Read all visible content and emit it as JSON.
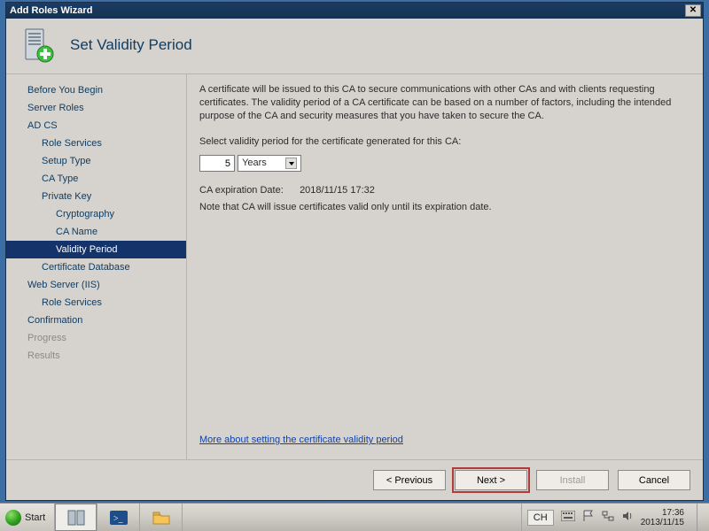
{
  "window": {
    "title": "Add Roles Wizard"
  },
  "header": {
    "heading": "Set Validity Period"
  },
  "sidebar": {
    "items": [
      {
        "label": "Before You Begin",
        "indent": 0
      },
      {
        "label": "Server Roles",
        "indent": 0
      },
      {
        "label": "AD CS",
        "indent": 0
      },
      {
        "label": "Role Services",
        "indent": 1
      },
      {
        "label": "Setup Type",
        "indent": 1
      },
      {
        "label": "CA Type",
        "indent": 1
      },
      {
        "label": "Private Key",
        "indent": 1
      },
      {
        "label": "Cryptography",
        "indent": 2
      },
      {
        "label": "CA Name",
        "indent": 2
      },
      {
        "label": "Validity Period",
        "indent": 2,
        "selected": true
      },
      {
        "label": "Certificate Database",
        "indent": 1
      },
      {
        "label": "Web Server (IIS)",
        "indent": 0
      },
      {
        "label": "Role Services",
        "indent": 1
      },
      {
        "label": "Confirmation",
        "indent": 0
      },
      {
        "label": "Progress",
        "indent": 0,
        "disabled": true
      },
      {
        "label": "Results",
        "indent": 0,
        "disabled": true
      }
    ]
  },
  "content": {
    "description": "A certificate will be issued to this CA to secure communications with other CAs and with clients requesting certificates. The validity period of a CA certificate can be based on a number of factors, including the intended purpose of the CA and security measures that you have taken to secure the CA.",
    "select_label": "Select validity period for the certificate generated for this CA:",
    "duration_value": "5",
    "duration_unit": "Years",
    "expiration_label": "CA expiration Date:",
    "expiration_value": "2018/11/15 17:32",
    "note": "Note that CA will issue certificates valid only until its expiration date.",
    "help_link": "More about setting the certificate validity period"
  },
  "footer": {
    "previous": "< Previous",
    "next": "Next >",
    "install": "Install",
    "cancel": "Cancel"
  },
  "taskbar": {
    "start": "Start",
    "ime": "CH",
    "time": "17:36",
    "date": "2013/11/15"
  }
}
